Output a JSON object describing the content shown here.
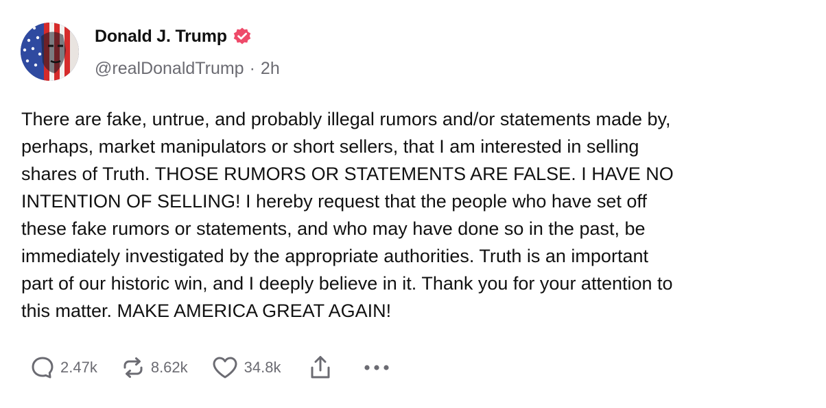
{
  "author": {
    "display_name": "Donald J. Trump",
    "handle": "@realDonaldTrump",
    "separator": "·",
    "time_ago": "2h",
    "verified": true,
    "verified_color": "#ee4b6a"
  },
  "post": {
    "text": "There are fake, untrue, and probably illegal rumors and/or statements made by,\nperhaps, market manipulators or short sellers, that I am interested in selling\nshares of Truth. THOSE RUMORS OR STATEMENTS ARE FALSE. I HAVE NO\nINTENTION OF SELLING! I hereby request that the people who have set off\nthese fake rumors or statements, and who may have done so in the past, be\nimmediately investigated by the appropriate authorities. Truth is an important\npart of our historic win, and I deeply believe in it. Thank you for your attention to\nthis matter. MAKE AMERICA GREAT AGAIN!"
  },
  "actions": {
    "reply_count": "2.47k",
    "retruth_count": "8.62k",
    "like_count": "34.8k",
    "reply_icon": "speech-bubble-icon",
    "retruth_icon": "repost-arrows-icon",
    "like_icon": "heart-icon",
    "share_icon": "share-upload-icon",
    "more_icon": "more-dots-icon",
    "icon_color": "#6b6b72"
  }
}
